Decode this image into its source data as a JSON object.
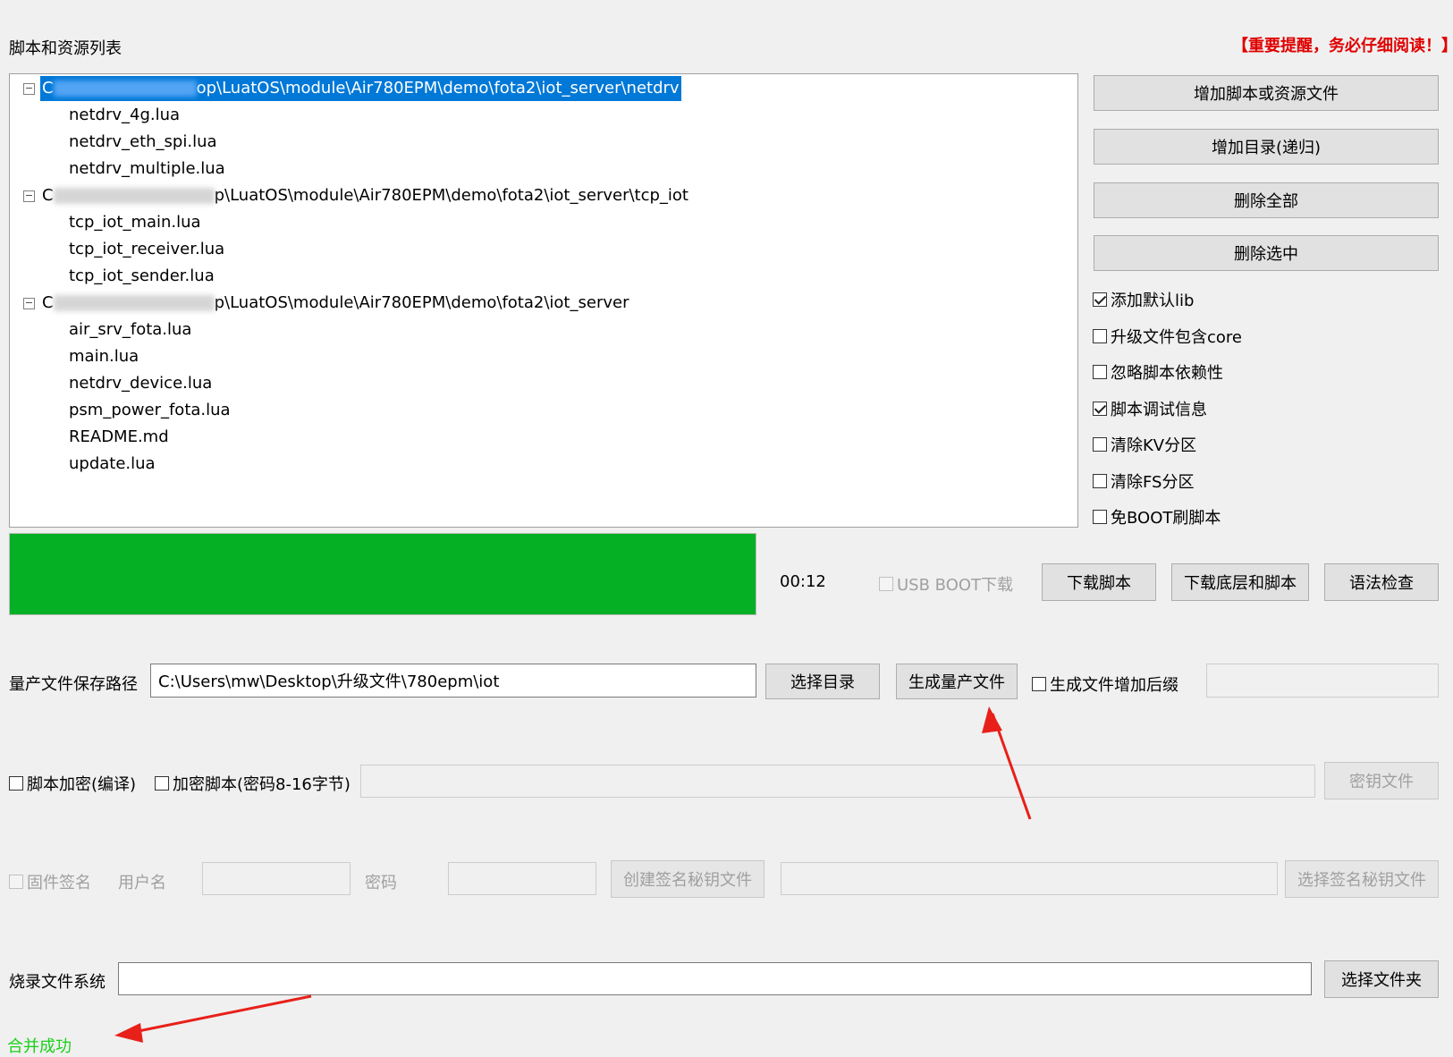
{
  "section": {
    "title": "脚本和资源列表",
    "warning": "【重要提醒，务必仔细阅读！】"
  },
  "tree": {
    "groups": [
      {
        "path_prefix": "C",
        "path_suffix": "op\\LuatOS\\module\\Air780EPM\\demo\\fota2\\iot_server\\netdrv",
        "selected": true,
        "files": [
          "netdrv_4g.lua",
          "netdrv_eth_spi.lua",
          "netdrv_multiple.lua"
        ]
      },
      {
        "path_prefix": "C",
        "path_suffix": "p\\LuatOS\\module\\Air780EPM\\demo\\fota2\\iot_server\\tcp_iot",
        "selected": false,
        "files": [
          "tcp_iot_main.lua",
          "tcp_iot_receiver.lua",
          "tcp_iot_sender.lua"
        ]
      },
      {
        "path_prefix": "C",
        "path_suffix": "p\\LuatOS\\module\\Air780EPM\\demo\\fota2\\iot_server",
        "selected": false,
        "files": [
          "air_srv_fota.lua",
          "main.lua",
          "netdrv_device.lua",
          "psm_power_fota.lua",
          "README.md",
          "update.lua"
        ]
      }
    ]
  },
  "side": {
    "buttons": [
      "增加脚本或资源文件",
      "增加目录(递归)",
      "删除全部",
      "删除选中"
    ],
    "options": [
      {
        "label": "添加默认lib",
        "checked": true
      },
      {
        "label": "升级文件包含core",
        "checked": false
      },
      {
        "label": "忽略脚本依赖性",
        "checked": false
      },
      {
        "label": "脚本调试信息",
        "checked": true
      },
      {
        "label": "清除KV分区",
        "checked": false
      },
      {
        "label": "清除FS分区",
        "checked": false
      },
      {
        "label": "免BOOT刷脚本",
        "checked": false
      }
    ]
  },
  "download": {
    "progress": 1.0,
    "elapsed": "00:12",
    "usb_boot_label": "USB BOOT下载",
    "download_script": "下载脚本",
    "download_all": "下载底层和脚本",
    "syntax_check": "语法检查"
  },
  "mass": {
    "label": "量产文件保存路径",
    "path": "C:\\Users\\mw\\Desktop\\升级文件\\780epm\\iot",
    "choose_dir": "选择目录",
    "generate": "生成量产文件",
    "suffix_label": "生成文件增加后缀",
    "suffix_value": ""
  },
  "encrypt": {
    "compile_label": "脚本加密(编译)",
    "password_label": "加密脚本(密码8-16字节)",
    "password_value": "",
    "key_file": "密钥文件"
  },
  "sign": {
    "label": "固件签名",
    "user_label": "用户名",
    "pass_label": "密码",
    "create_key": "创建签名秘钥文件",
    "choose_key": "选择签名秘钥文件"
  },
  "fs": {
    "label": "烧录文件系统",
    "value": "",
    "choose_folder": "选择文件夹"
  },
  "status": {
    "text": "合并成功",
    "color": "#18d018"
  },
  "colors": {
    "selection": "#0078d7",
    "progress": "#06b025",
    "warning": "#e00000",
    "arrow": "#e8201a"
  }
}
